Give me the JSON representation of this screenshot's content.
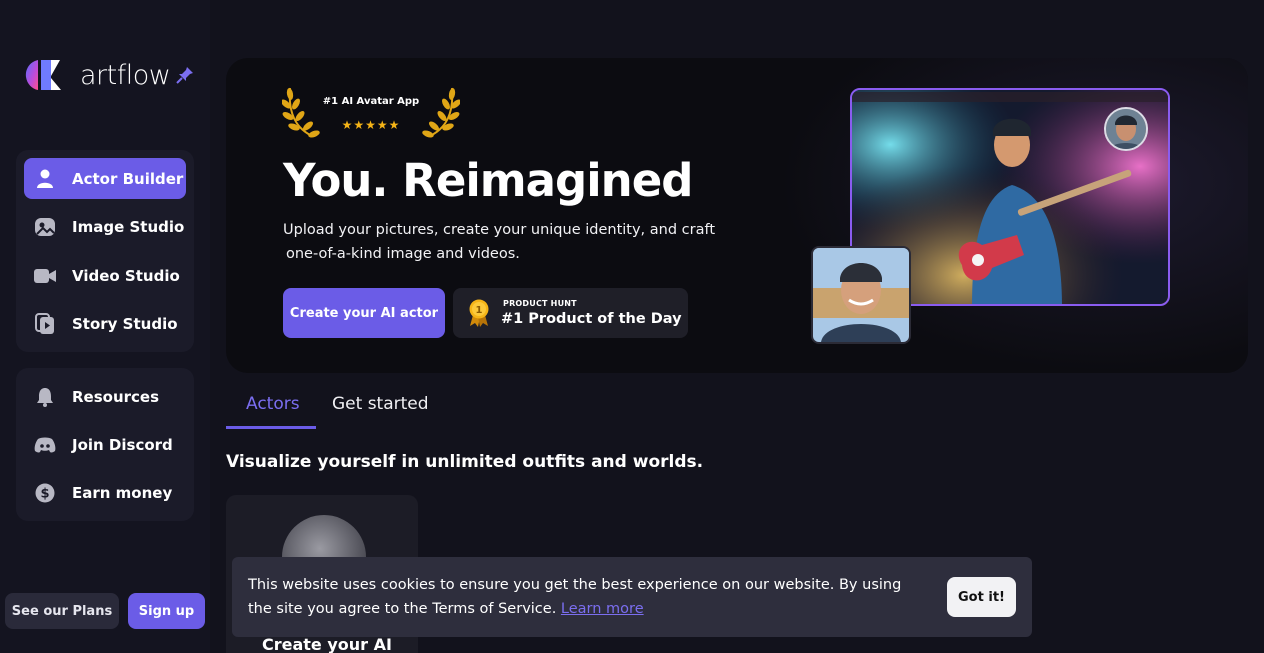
{
  "brand": {
    "name": "artflow"
  },
  "nav": {
    "primary": [
      {
        "label": "Actor Builder",
        "icon": "user-icon",
        "active": true
      },
      {
        "label": "Image Studio",
        "icon": "image-icon",
        "active": false
      },
      {
        "label": "Video Studio",
        "icon": "video-camera-icon",
        "active": false
      },
      {
        "label": "Story Studio",
        "icon": "story-icon",
        "active": false
      }
    ],
    "secondary": [
      {
        "label": "Resources",
        "icon": "bell-icon"
      },
      {
        "label": "Join Discord",
        "icon": "discord-icon"
      },
      {
        "label": "Earn money",
        "icon": "dollar-icon"
      }
    ]
  },
  "footer": {
    "plans_label": "See our Plans",
    "signup_label": "Sign up"
  },
  "hero": {
    "award_title": "#1 AI Avatar App",
    "award_stars": "★★★★★",
    "title": "You. Reimagined",
    "subtitle_line1": "Upload your pictures, create your unique identity, and craft",
    "subtitle_line2": "one-of-a-kind image and videos.",
    "cta_label": "Create your AI actor",
    "product_hunt_small": "PRODUCT HUNT",
    "product_hunt_big": "#1 Product of the Day",
    "product_hunt_rank": "1"
  },
  "tabs": [
    {
      "label": "Actors",
      "active": true
    },
    {
      "label": "Get started",
      "active": false
    }
  ],
  "section": {
    "heading": "Visualize yourself in unlimited outfits and worlds.",
    "card_label": "Create your AI"
  },
  "cookie": {
    "text_line1": "This website uses cookies to ensure you get the best experience on our website. By using",
    "text_line2": "the site you agree to the Terms of Service.",
    "link_label": "Learn more",
    "button_label": "Got it!"
  },
  "colors": {
    "accent": "#6b5ce7",
    "background": "#12121c",
    "gold": "#f5b417"
  }
}
